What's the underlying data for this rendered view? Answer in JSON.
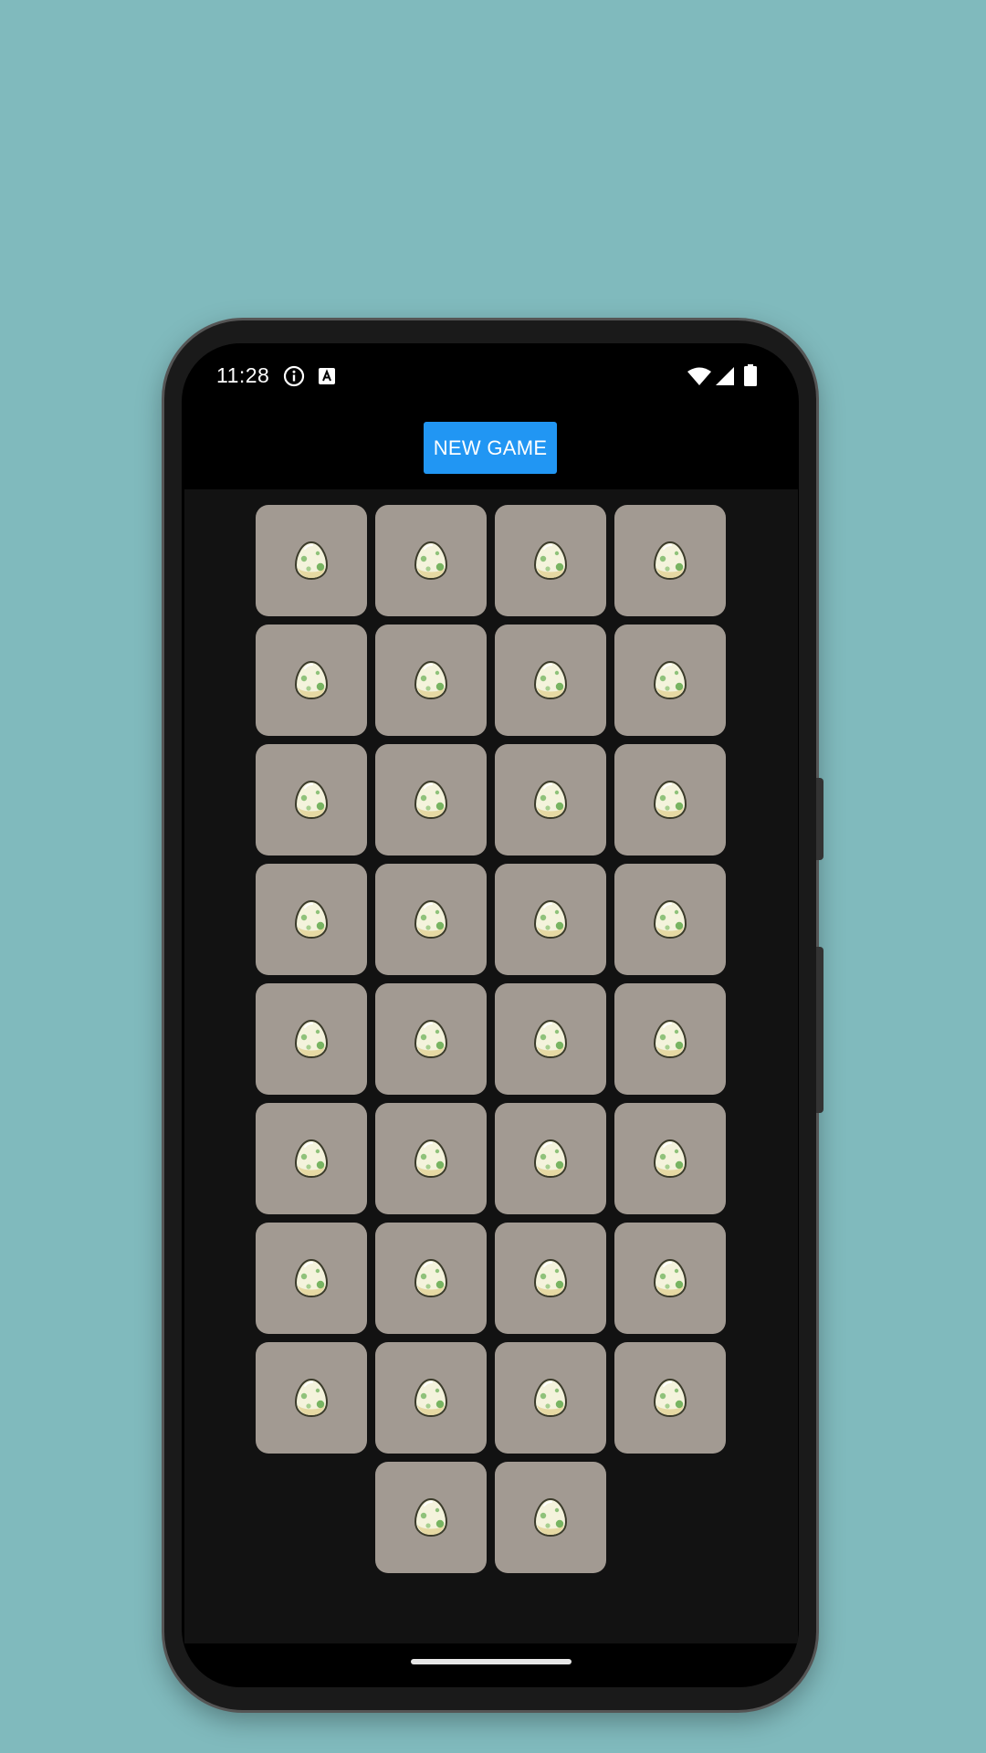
{
  "status_bar": {
    "time": "11:28",
    "left_icons": [
      "info-icon",
      "keyboard-a-icon"
    ],
    "right_icons": [
      "wifi-icon",
      "cellular-signal-icon",
      "battery-icon"
    ]
  },
  "new_game_label": "NEW GAME",
  "board": {
    "card_count": 34,
    "columns": 4,
    "card_face": "egg-icon",
    "colors": {
      "card": "#a29a92",
      "board": "#121212",
      "button": "#2196f3",
      "background": "#80babd"
    }
  }
}
